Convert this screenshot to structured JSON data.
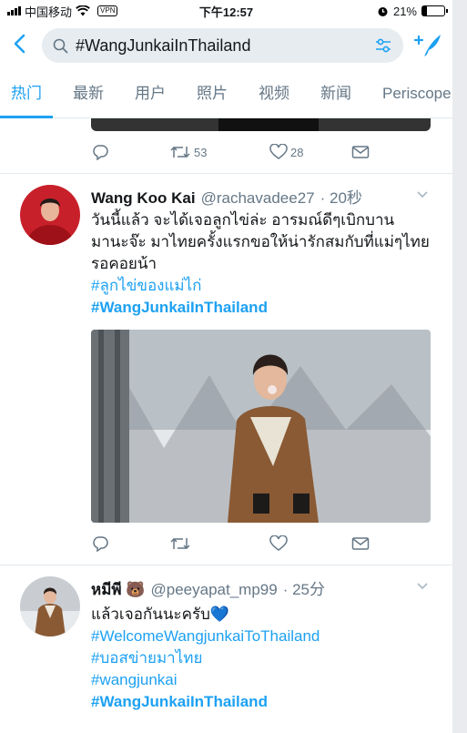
{
  "status_bar": {
    "carrier": "中国移动",
    "vpn": "VPN",
    "time": "下午12:57",
    "battery": "21%",
    "battery_level": 0.21
  },
  "search": {
    "query": "#WangJunkaiInThailand"
  },
  "tabs": [
    {
      "label": "热门",
      "active": true
    },
    {
      "label": "最新"
    },
    {
      "label": "用户"
    },
    {
      "label": "照片"
    },
    {
      "label": "视频"
    },
    {
      "label": "新闻"
    },
    {
      "label": "Periscope"
    }
  ],
  "prev_tweet": {
    "retweets": "53",
    "likes": "28"
  },
  "tweets": [
    {
      "name": "Wang Koo Kai",
      "handle": "@rachavadee27",
      "time": "· 20秒",
      "text": "วันนี้แล้ว จะได้เจอลูกไข่ล่ะ อารมณ์ดีๆเบิกบานมานะจ๊ะ มาไทยครั้งแรกขอให้น่ารักสมกับที่แม่ๆไทยรอคอยน้า",
      "hashtags": [
        "#ลูกไข่ของแม่ไก่",
        "#WangJunkaiInThailand"
      ]
    },
    {
      "name": "หมีพี 🐻",
      "handle": "@peeyapat_mp99",
      "time": "· 25分",
      "text": "แล้วเจอกันนะครับ💙",
      "hashtags": [
        "#WelcomeWangjunkaiToThailand",
        "#บอสข่ายมาไทย",
        "#wangjunkai",
        "#WangJunkaiInThailand"
      ]
    }
  ],
  "colors": {
    "accent": "#1da1f2",
    "secondary_text": "#657786",
    "search_bg": "#e6ecf0"
  }
}
